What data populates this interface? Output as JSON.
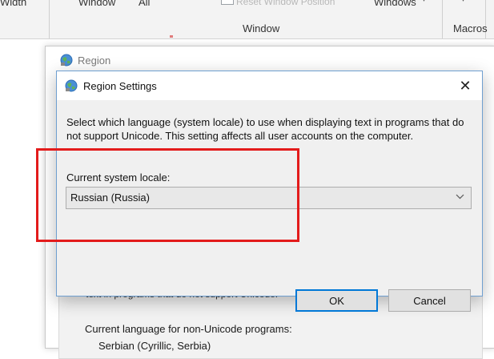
{
  "ribbon": {
    "width_label": "Width",
    "window_item": "Window",
    "all_item": "All",
    "reset_position": "Reset Window Position",
    "windows_button": "Windows",
    "window_group": "Window",
    "macros_group": "Macros"
  },
  "region": {
    "title": "Region",
    "cut_text": "text in programs that do not support Unicode.",
    "language_label": "Current language for non-Unicode programs:",
    "language_value": "Serbian (Cyrillic, Serbia)"
  },
  "dialog": {
    "title": "Region Settings",
    "close_glyph": "✕",
    "description": "Select which language (system locale) to use when displaying text in programs that do not support Unicode. This setting affects all user accounts on the computer.",
    "locale_label": "Current system locale:",
    "locale_value": "Russian (Russia)",
    "ok_label": "OK",
    "cancel_label": "Cancel"
  },
  "colors": {
    "highlight": "#e31b1b",
    "dialog_border": "#6f9fd0",
    "default_button_border": "#0078d7"
  },
  "icons": [
    "globe-icon",
    "close-icon",
    "chevron-down-icon",
    "dropdown-arrow-icon"
  ]
}
